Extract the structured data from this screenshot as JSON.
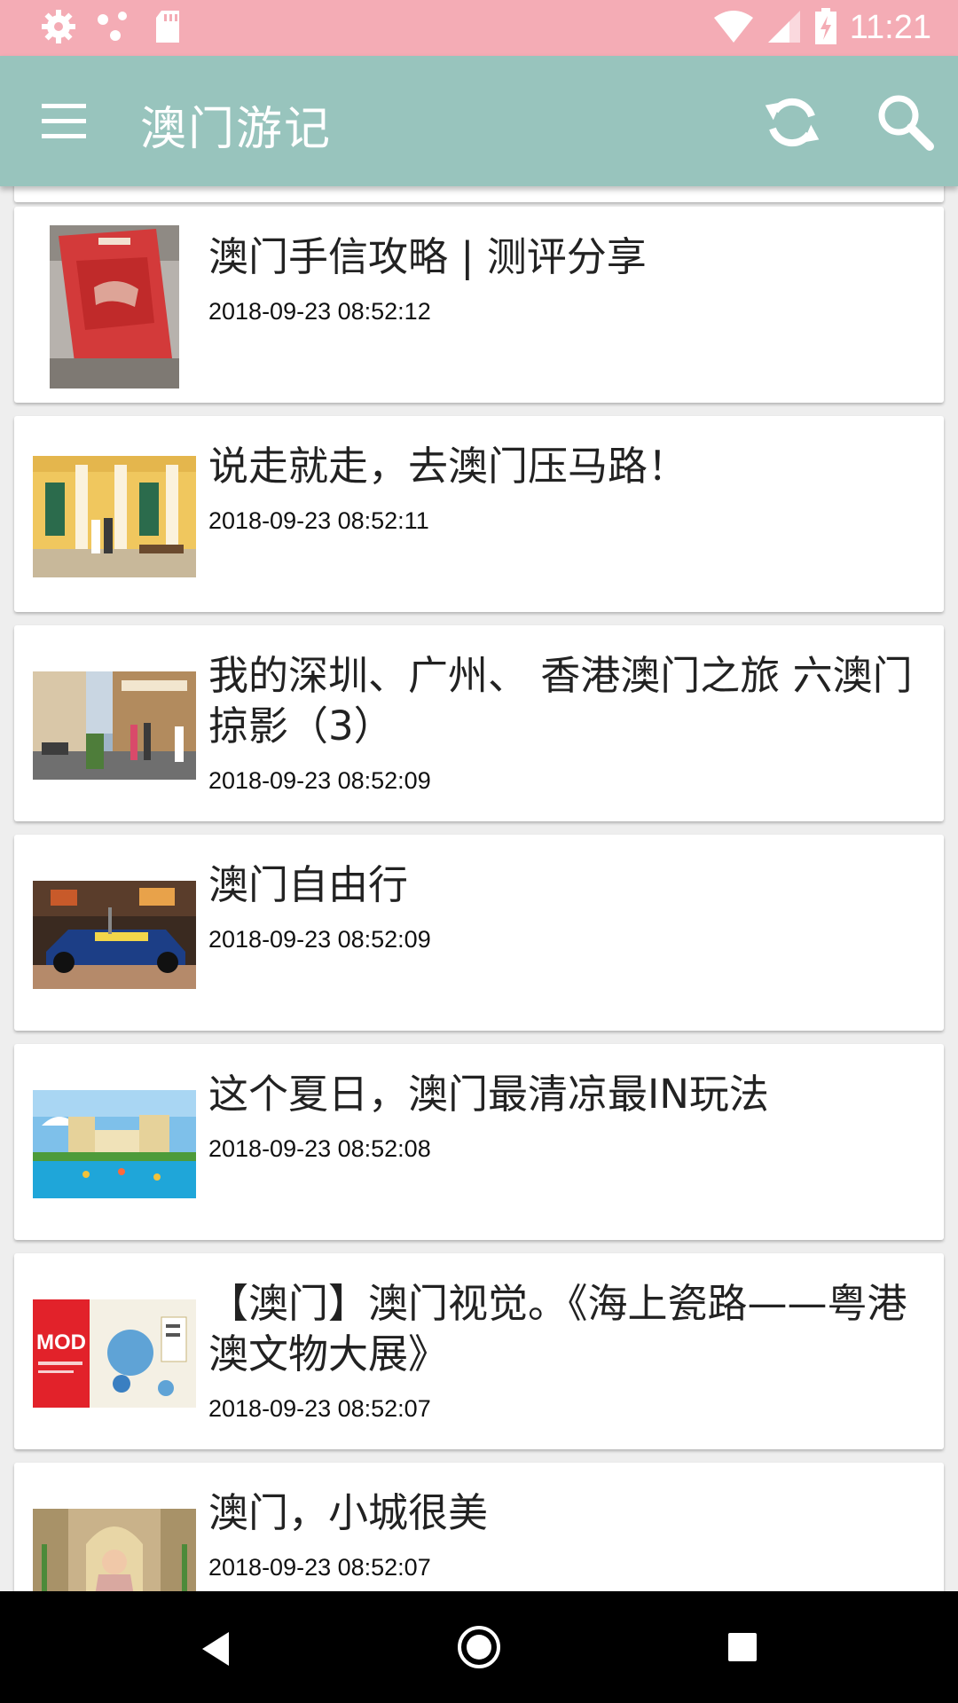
{
  "status_bar": {
    "time": "11:21",
    "icons": [
      "settings-icon",
      "dots-icon",
      "sd-card-icon",
      "wifi-icon",
      "signal-icon",
      "battery-charging-icon"
    ]
  },
  "app_bar": {
    "title": "澳门游记",
    "menu_icon": "menu-icon",
    "refresh_icon": "refresh-icon",
    "search_icon": "search-icon"
  },
  "articles": [
    {
      "title": "澳门手信攻略 | 测评分享",
      "date": "2018-09-23 08:52:12",
      "thumb": "red-snack-bag"
    },
    {
      "title": "说走就走，去澳门压马路！",
      "date": "2018-09-23 08:52:11",
      "thumb": "yellow-colonial-building"
    },
    {
      "title": "我的深圳、广州、 香港澳门之旅 六澳门掠影（3）",
      "date": "2018-09-23 08:52:09",
      "thumb": "street-scene"
    },
    {
      "title": "澳门自由行",
      "date": "2018-09-23 08:52:09",
      "thumb": "race-car-display"
    },
    {
      "title": "这个夏日，澳门最清凉最IN玩法",
      "date": "2018-09-23 08:52:08",
      "thumb": "resort-pool"
    },
    {
      "title": "【澳门】澳门视觉。《海上瓷路——粤港澳文物大展》",
      "date": "2018-09-23 08:52:07",
      "thumb": "exhibition-poster"
    },
    {
      "title": "澳门，小城很美",
      "date": "2018-09-23 08:52:07",
      "thumb": "church-statue"
    }
  ],
  "thumb_texts": {
    "poster_logo": "MOD"
  },
  "nav_bar": {
    "icons": [
      "back-icon",
      "home-icon",
      "recent-apps-icon"
    ]
  },
  "colors": {
    "status_bar": "#f4acb5",
    "app_bar": "#98c4bd",
    "background": "#eeeeee",
    "card": "#ffffff",
    "nav_bar": "#000000"
  }
}
